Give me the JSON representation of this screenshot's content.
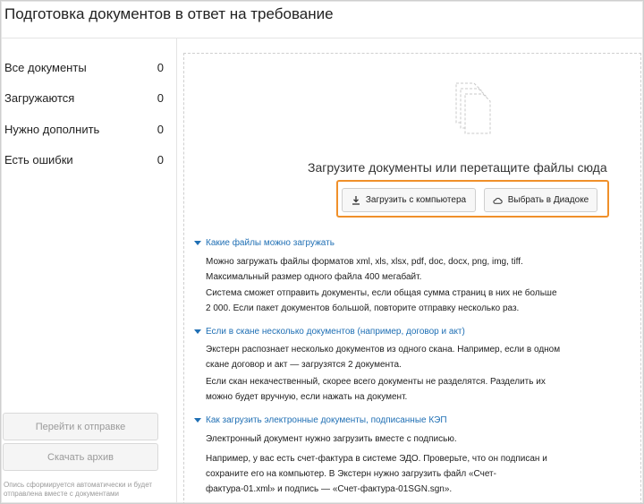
{
  "header": {
    "title": "Подготовка документов в ответ на требование"
  },
  "sidebar": {
    "items": [
      {
        "label": "Все документы",
        "count": "0"
      },
      {
        "label": "Загружаются",
        "count": "0"
      },
      {
        "label": "Нужно дополнить",
        "count": "0"
      },
      {
        "label": "Есть ошибки",
        "count": "0"
      }
    ],
    "send_button": "Перейти к отправке",
    "archive_button": "Скачать архив",
    "note": "Опись сформируется автоматически и будет отправлена вместе с документами"
  },
  "dropzone": {
    "title": "Загрузите документы или перетащите файлы сюда",
    "upload_button": "Загрузить с компьютера",
    "diadoc_button": "Выбрать в Диадоке",
    "highlight_color": "#f0902a"
  },
  "sections": [
    {
      "heading": "Какие файлы можно загружать",
      "paragraphs": [
        "Можно загружать файлы форматов xml, xls, xlsx, pdf, doc, docx, png, img, tiff. Максимальный размер одного файла 400 мегабайт.",
        "Система сможет отправить документы, если общая сумма страниц в них не больше 2 000. Если пакет документов большой, повторите отправку несколько раз."
      ]
    },
    {
      "heading": "Если в скане несколько документов (например, договор и акт)",
      "paragraphs": [
        "Экстерн распознает несколько документов из одного скана. Например, если в одном скане договор и акт — загрузятся 2 документа.",
        "Если скан некачественный, скорее всего документы не разделятся. Разделить их можно будет вручную, если нажать на документ."
      ]
    },
    {
      "heading": "Как загрузить электронные документы, подписанные КЭП",
      "paragraphs": [
        "Электронный документ нужно загрузить вместе с подписью.",
        "Например, у вас есть счет-фактура в системе ЭДО. Проверьте, что он подписан и сохраните его на компьютер. В Экстерн нужно загрузить файл «Счет-фактура-01.xml» и подпись — «Счет-фактура-01SGN.sgn»."
      ]
    }
  ],
  "colors": {
    "link": "#1f6fb4",
    "accent": "#f0902a"
  }
}
